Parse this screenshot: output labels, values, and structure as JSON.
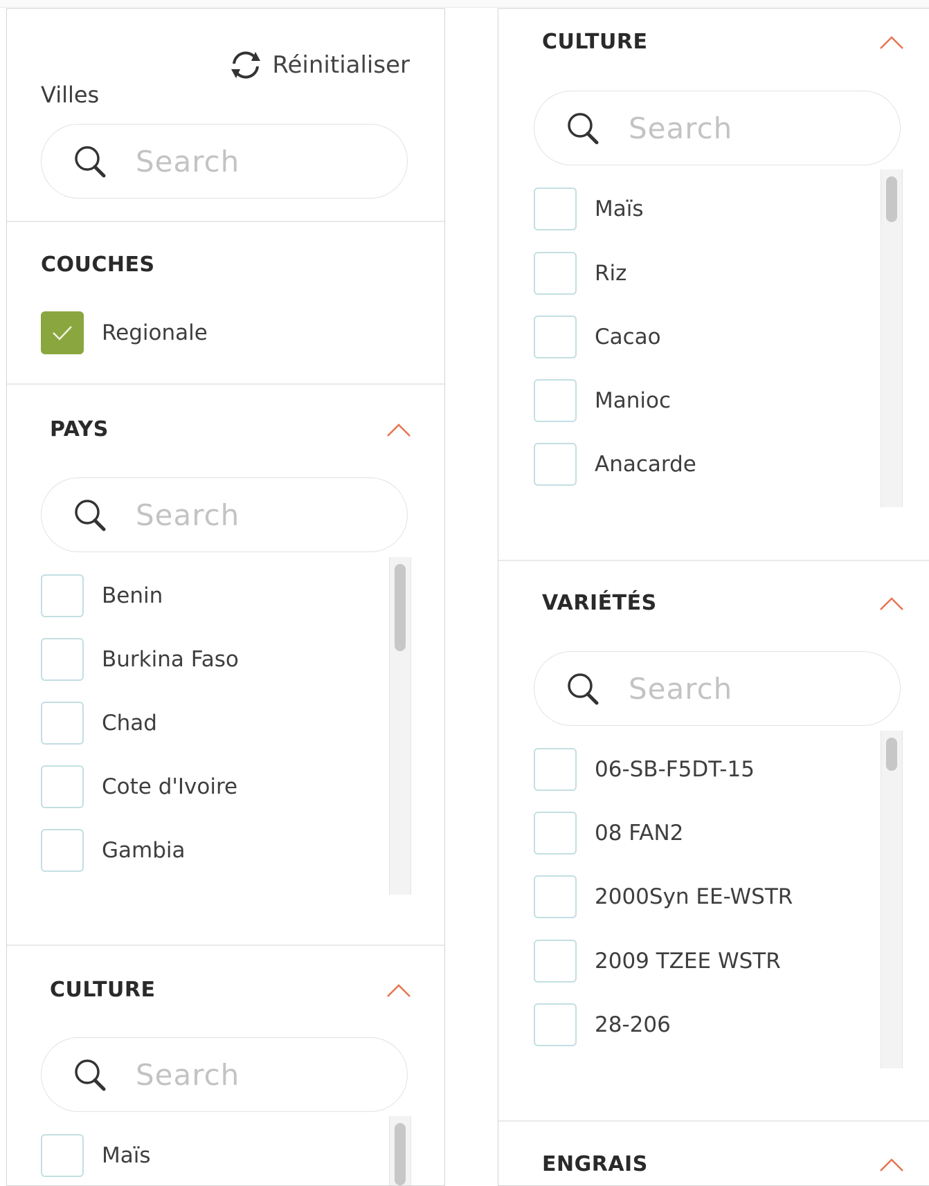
{
  "left": {
    "reset_label": "Réinitialiser",
    "villes_label": "Villes",
    "villes_search_placeholder": "Search",
    "couches": {
      "title": "COUCHES",
      "item_label": "Regionale",
      "item_checked": true
    },
    "pays": {
      "title": "PAYS",
      "search_placeholder": "Search",
      "items": [
        "Benin",
        "Burkina Faso",
        "Chad",
        "Cote d'Ivoire",
        "Gambia"
      ]
    },
    "culture": {
      "title": "CULTURE",
      "search_placeholder": "Search",
      "items": [
        "Maïs"
      ]
    }
  },
  "right": {
    "culture": {
      "title": "CULTURE",
      "search_placeholder": "Search",
      "items": [
        "Maïs",
        "Riz",
        "Cacao",
        "Manioc",
        "Anacarde"
      ]
    },
    "varietes": {
      "title": "VARIÉTÉS",
      "search_placeholder": "Search",
      "items": [
        "06-SB-F5DT-15",
        "08 FAN2",
        "2000Syn EE-WSTR",
        "2009 TZEE WSTR",
        "28-206"
      ]
    },
    "engrais": {
      "title": "ENGRAIS"
    }
  },
  "colors": {
    "accent_green": "#8aa63f",
    "chevron_orange": "#e8734f",
    "checkbox_border": "#c3dfe2"
  }
}
